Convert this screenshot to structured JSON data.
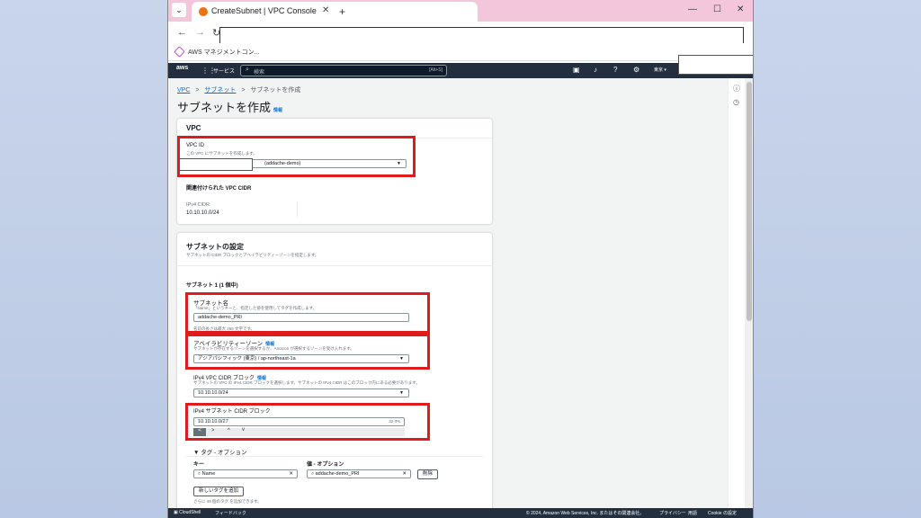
{
  "browser": {
    "tab_title": "CreateSubnet | VPC Console",
    "tab_close": "✕",
    "new_tab": "+",
    "bookmark_label": "AWS マネジメントコン...",
    "win_min": "—",
    "win_max": "☐",
    "win_close": "✕"
  },
  "aws_header": {
    "logo": "aws",
    "services": "サービス",
    "search_placeholder": "検索",
    "search_shortcut": "[Alt+S]",
    "region": "東京 ▾"
  },
  "breadcrumb": {
    "vpc": "VPC",
    "subnets": "サブネット",
    "current": "サブネットを作成",
    "sep": ">"
  },
  "page": {
    "title": "サブネットを作成",
    "info": "情報"
  },
  "vpc_card": {
    "title": "VPC",
    "vpc_id_label": "VPC ID",
    "vpc_id_desc": "この VPC にサブネットを作成します。",
    "vpc_id_value": "(addache-demo)",
    "assoc_cidr_title": "関連付けられた VPC CIDR",
    "ipv4_cidr_label": "IPv4 CIDR",
    "ipv4_cidr_value": "10.10.10.0/24"
  },
  "subnet_card": {
    "title": "サブネットの設定",
    "desc": "サブネットの CIDR ブロックとアベイラビリティーゾーンを指定します。",
    "subnet_heading": "サブネット 1 (1 個中)",
    "name_label": "サブネット名",
    "name_desc": "「Name」というキーと、指定した値を使用してタグを作成します。",
    "name_value": "addache-demo_PRI",
    "name_hint": "名前の長さは最大 256 文字です。",
    "az_label": "アベイラビリティーゾーン",
    "az_info": "情報",
    "az_desc": "サブネットが存在するゾーンを選択するか、Amazon が選択するゾーンを受け入れます。",
    "az_value": "アジアパシフィック (東京) / ap-northeast-1a",
    "vpc_cidr_label": "IPv4 VPC CIDR ブロック",
    "vpc_cidr_info": "情報",
    "vpc_cidr_desc": "サブネットの VPC の IPv4 CIDR ブロックを選択します。サブネットの IPv4 CIDR はこのブロック内にある必要があります。",
    "vpc_cidr_value": "10.10.10.0/24",
    "subnet_cidr_label": "IPv4 サブネット CIDR ブロック",
    "subnet_cidr_value": "10.10.10.0/27",
    "subnet_cidr_count": "32 IPs",
    "step_prev": "<",
    "step_next": ">",
    "step_up": "^",
    "step_down": "v",
    "tags_toggle": "▼ タグ - オプション",
    "key_header": "キー",
    "value_header": "値 - オプション",
    "tag_key": "Name",
    "tag_value": "addache-demo_PRI",
    "remove_button": "削除",
    "add_tag_button": "新しいタグを追加",
    "tag_limit": "さらに 49 個のタグ を追加できます。"
  },
  "footer": {
    "cloudshell": "CloudShell",
    "feedback": "フィードバック",
    "copyright": "© 2024, Amazon Web Services, Inc. またはその関連会社。",
    "privacy": "プライバシー",
    "terms": "用語",
    "cookie": "Cookie の設定"
  }
}
